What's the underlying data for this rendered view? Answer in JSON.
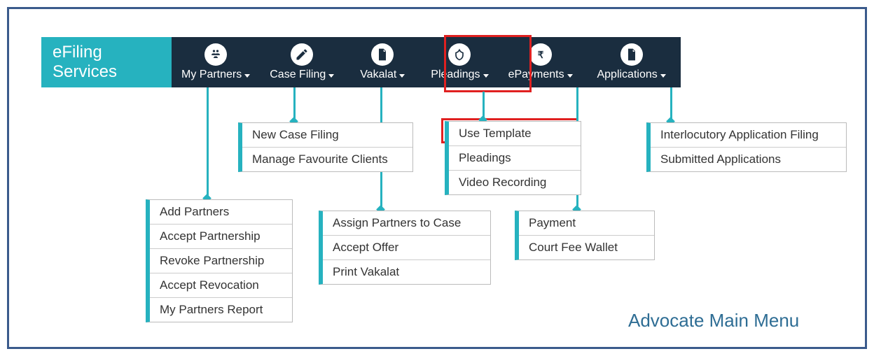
{
  "brand": "eFiling Services",
  "caption": "Advocate Main Menu",
  "nav": {
    "my_partners": "My Partners",
    "case_filing": "Case Filing",
    "vakalat": "Vakalat",
    "pleadings": "Pleadings",
    "epayments": "ePayments",
    "applications": "Applications"
  },
  "menus": {
    "my_partners": [
      "Add Partners",
      "Accept Partnership",
      "Revoke Partnership",
      "Accept Revocation",
      "My Partners Report"
    ],
    "case_filing": [
      "New Case Filing",
      "Manage Favourite Clients"
    ],
    "vakalat": [
      "Assign Partners to Case",
      "Accept Offer",
      "Print Vakalat"
    ],
    "pleadings": [
      "Use Template",
      "Pleadings",
      "Video Recording"
    ],
    "epayments": [
      "Payment",
      "Court Fee Wallet"
    ],
    "applications": [
      "Interlocutory Application Filing",
      "Submitted Applications"
    ]
  },
  "colors": {
    "accent": "#26b2bf",
    "navbar": "#1a2d3f",
    "frame": "#3b5b8c",
    "highlight": "#e02020"
  }
}
